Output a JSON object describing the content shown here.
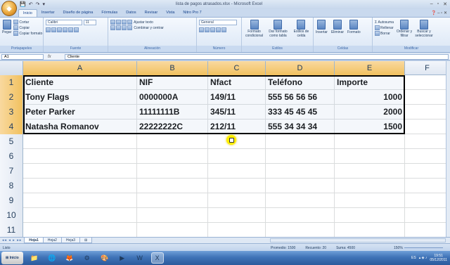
{
  "window": {
    "title": "lista de pagos atrasados.xlsx - Microsoft Excel",
    "qat": [
      "💾",
      "↶",
      "↷",
      "▾"
    ],
    "controls": [
      "–",
      "▫",
      "✕"
    ],
    "help": "❓ – ▫ ✕"
  },
  "ribbon_tabs": [
    "Inicio",
    "Insertar",
    "Diseño de página",
    "Fórmulas",
    "Datos",
    "Revisar",
    "Vista",
    "Nitro Pro 7"
  ],
  "ribbon": {
    "clipboard": {
      "paste": "Pegar",
      "cut": "Cortar",
      "copy": "Copiar",
      "format_painter": "Copiar formato",
      "label": "Portapapeles"
    },
    "font": {
      "name": "Calibri",
      "size": "11",
      "label": "Fuente"
    },
    "alignment": {
      "wrap": "Ajustar texto",
      "merge": "Combinar y centrar",
      "label": "Alineación"
    },
    "number": {
      "format": "General",
      "label": "Número"
    },
    "styles": {
      "conditional": "Formato condicional",
      "as_table": "Dar formato como tabla",
      "cell_styles": "Estilos de celda",
      "label": "Estilos"
    },
    "cells": {
      "insert": "Insertar",
      "delete": "Eliminar",
      "format": "Formato",
      "label": "Celdas"
    },
    "editing": {
      "autosum": "Autosuma",
      "fill": "Rellenar",
      "clear": "Borrar",
      "sort": "Ordenar y filtrar",
      "find": "Buscar y seleccionar",
      "label": "Modificar"
    }
  },
  "formula_bar": {
    "name_box": "A1",
    "fx": "fx",
    "content": "Cliente"
  },
  "columns": [
    "A",
    "B",
    "C",
    "D",
    "E",
    "F"
  ],
  "rows": [
    {
      "num": "1",
      "cells": [
        "Cliente",
        "NIF",
        "Nfact",
        "Teléfono",
        "Importe",
        ""
      ]
    },
    {
      "num": "2",
      "cells": [
        "Tony Flags",
        "0000000A",
        "149/11",
        "555 56 56 56",
        "1000",
        ""
      ]
    },
    {
      "num": "3",
      "cells": [
        "Peter Parker",
        "11111111B",
        "345/11",
        "333 45 45 45",
        "2000",
        ""
      ]
    },
    {
      "num": "4",
      "cells": [
        "Natasha Romanov",
        "22222222C",
        "212/11",
        "555 34 34 34",
        "1500",
        ""
      ]
    },
    {
      "num": "5",
      "cells": [
        "",
        "",
        "",
        "",
        "",
        ""
      ]
    },
    {
      "num": "6",
      "cells": [
        "",
        "",
        "",
        "",
        "",
        ""
      ]
    },
    {
      "num": "7",
      "cells": [
        "",
        "",
        "",
        "",
        "",
        ""
      ]
    },
    {
      "num": "8",
      "cells": [
        "",
        "",
        "",
        "",
        "",
        ""
      ]
    },
    {
      "num": "9",
      "cells": [
        "",
        "",
        "",
        "",
        "",
        ""
      ]
    },
    {
      "num": "10",
      "cells": [
        "",
        "",
        "",
        "",
        "",
        ""
      ]
    },
    {
      "num": "11",
      "cells": [
        "",
        "",
        "",
        "",
        "",
        ""
      ]
    }
  ],
  "sheets": [
    "Hoja1",
    "Hoja2",
    "Hoja3"
  ],
  "status": {
    "mode": "Listo",
    "average": "Promedio: 1500",
    "count": "Recuento: 20",
    "sum": "Suma: 4500",
    "zoom": "150%"
  },
  "taskbar": {
    "start": "Inicio",
    "lang": "ES",
    "time": "19:51",
    "date": "05/12/2011"
  },
  "colors": {
    "selected_header": "#f1c15f",
    "ribbon_text": "#15428b",
    "taskbar": "#3f73b7"
  }
}
